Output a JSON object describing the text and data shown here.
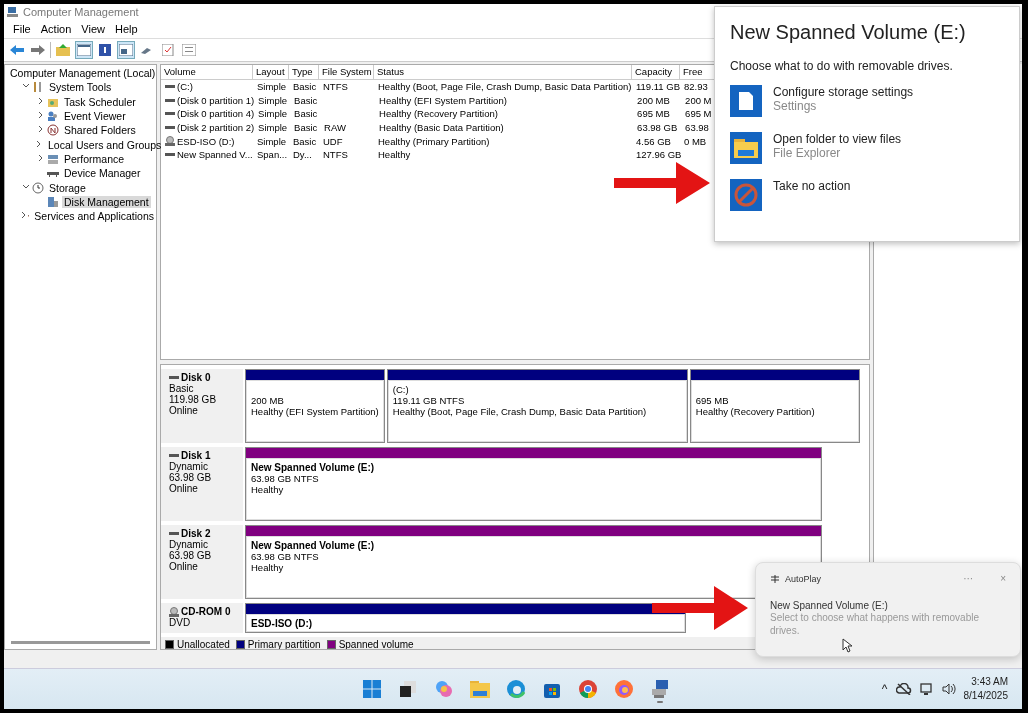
{
  "window": {
    "title": "Computer Management"
  },
  "menu": [
    "File",
    "Action",
    "View",
    "Help"
  ],
  "toolbar": [
    {
      "pressed": false
    },
    {
      "pressed": false
    },
    {
      "pressed": false
    },
    {
      "pressed": true
    },
    {
      "pressed": false
    },
    {
      "pressed": true
    },
    {
      "pressed": false
    },
    {
      "pressed": false
    },
    {
      "pressed": false
    }
  ],
  "tree": [
    {
      "label": "Computer Management (Local)",
      "selected": false,
      "children": [
        {
          "label": "System Tools",
          "expanded": true,
          "selected": false,
          "children": [
            {
              "label": "Task Scheduler",
              "expanded": false,
              "selected": false
            },
            {
              "label": "Event Viewer",
              "expanded": false,
              "selected": false
            },
            {
              "label": "Shared Folders",
              "expanded": false,
              "selected": false
            },
            {
              "label": "Local Users and Groups",
              "expanded": false,
              "selected": false
            },
            {
              "label": "Performance",
              "expanded": false,
              "selected": false
            },
            {
              "label": "Device Manager",
              "selected": false
            }
          ]
        },
        {
          "label": "Storage",
          "expanded": true,
          "selected": false,
          "children": [
            {
              "label": "Disk Management",
              "selected": true
            }
          ]
        },
        {
          "label": "Services and Applications",
          "expanded": false,
          "selected": false
        }
      ]
    }
  ],
  "volumes": {
    "columns": [
      "Volume",
      "Layout",
      "Type",
      "File System",
      "Status",
      "Capacity",
      "Free"
    ],
    "rows": [
      {
        "kind": "disk",
        "cells": [
          "(C:)",
          "Simple",
          "Basic",
          "NTFS",
          "Healthy (Boot, Page File, Crash Dump, Basic Data Partition)",
          "119.11 GB",
          "82.93"
        ]
      },
      {
        "kind": "disk",
        "cells": [
          "(Disk 0 partition 1)",
          "Simple",
          "Basic",
          "",
          "Healthy (EFI System Partition)",
          "200 MB",
          "200 M"
        ]
      },
      {
        "kind": "disk",
        "cells": [
          "(Disk 0 partition 4)",
          "Simple",
          "Basic",
          "",
          "Healthy (Recovery Partition)",
          "695 MB",
          "695 M"
        ]
      },
      {
        "kind": "disk",
        "cells": [
          "(Disk 2 partition 2)",
          "Simple",
          "Basic",
          "RAW",
          "Healthy (Basic Data Partition)",
          "63.98 GB",
          "63.98"
        ]
      },
      {
        "kind": "cdrom",
        "cells": [
          "ESD-ISO (D:)",
          "Simple",
          "Basic",
          "UDF",
          "Healthy (Primary Partition)",
          "4.56 GB",
          "0 MB"
        ]
      },
      {
        "kind": "disk",
        "cells": [
          "New Spanned V...",
          "Span...",
          "Dy...",
          "NTFS",
          "Healthy",
          "127.96 GB",
          ""
        ]
      }
    ]
  },
  "disks": [
    {
      "kind": "disk",
      "name": "Disk 0",
      "type": "Basic",
      "size": "119.98 GB",
      "status": "Online",
      "partitions": [
        {
          "color": "#00007f",
          "size": "200 MB",
          "status": "Healthy (EFI System Partition)"
        },
        {
          "color": "#00007f",
          "label": "(C:)",
          "size": "119.11 GB NTFS",
          "status": "Healthy (Boot, Page File, Crash Dump, Basic Data Partition)"
        },
        {
          "color": "#00007f",
          "size": "695 MB",
          "status": "Healthy (Recovery Partition)"
        }
      ]
    },
    {
      "kind": "disk",
      "name": "Disk 1",
      "type": "Dynamic",
      "size": "63.98 GB",
      "status": "Online",
      "partitions": [
        {
          "color": "#800080",
          "label": "New Spanned Volume  (E:)",
          "size": "63.98 GB NTFS",
          "status": "Healthy"
        }
      ]
    },
    {
      "kind": "disk",
      "name": "Disk 2",
      "type": "Dynamic",
      "size": "63.98 GB",
      "status": "Online",
      "partitions": [
        {
          "color": "#800080",
          "label": "New Spanned Volume  (E:)",
          "size": "63.98 GB NTFS",
          "status": "Healthy"
        }
      ]
    },
    {
      "kind": "cdrom",
      "name": "CD-ROM 0",
      "type": "DVD",
      "partitions": [
        {
          "color": "#00007f",
          "label": "ESD-ISO  (D:)"
        }
      ]
    }
  ],
  "legend": [
    {
      "label": "Unallocated",
      "color": "#000000"
    },
    {
      "label": "Primary partition",
      "color": "#00007f"
    },
    {
      "label": "Spanned volume",
      "color": "#800080"
    }
  ],
  "autoplay_dialog": {
    "title": "New Spanned Volume (E:)",
    "subtitle": "Choose what to do with removable drives.",
    "options": [
      {
        "kind": "storage",
        "label": "Configure storage settings",
        "detail": "Settings"
      },
      {
        "kind": "folder",
        "label": "Open folder to view files",
        "detail": "File Explorer"
      },
      {
        "kind": "none",
        "label": "Take no action"
      }
    ]
  },
  "toast": {
    "app": "AutoPlay",
    "more": "···",
    "close": "×",
    "title": "New Spanned Volume (E:)",
    "body": "Select to choose what happens with removable drives."
  },
  "taskbar": {
    "apps": [
      {
        "running": false
      },
      {
        "running": false
      },
      {
        "running": false
      },
      {
        "running": false
      },
      {
        "running": false
      },
      {
        "running": false
      },
      {
        "running": false
      },
      {
        "running": false
      },
      {
        "running": true
      }
    ],
    "tray_chevron": "^",
    "time": "3:43 AM",
    "date": "8/14/2025"
  }
}
